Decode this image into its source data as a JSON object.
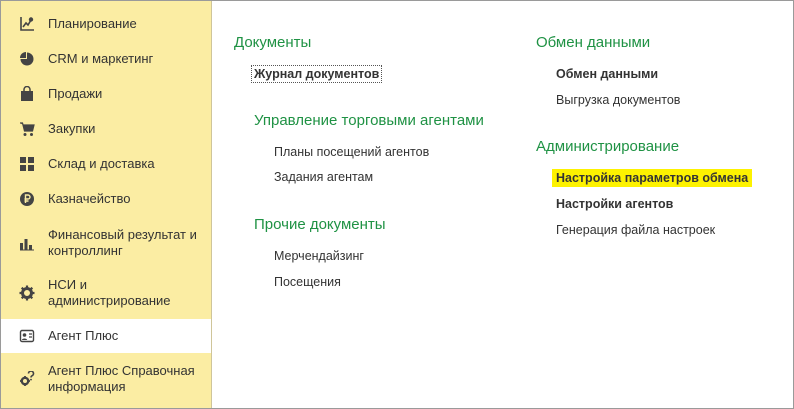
{
  "sidebar": {
    "items": [
      {
        "label": "Планирование",
        "icon": "chart-growth-icon"
      },
      {
        "label": "CRM и маркетинг",
        "icon": "pie-chart-icon"
      },
      {
        "label": "Продажи",
        "icon": "shopping-bag-icon"
      },
      {
        "label": "Закупки",
        "icon": "shopping-cart-icon"
      },
      {
        "label": "Склад и доставка",
        "icon": "grid-icon"
      },
      {
        "label": "Казначейство",
        "icon": "ruble-coin-icon"
      },
      {
        "label": "Финансовый результат и контроллинг",
        "icon": "bar-chart-icon"
      },
      {
        "label": "НСИ и администрирование",
        "icon": "gear-icon"
      },
      {
        "label": "Агент Плюс",
        "icon": "agent-plus-icon",
        "active": true
      },
      {
        "label": "Агент Плюс Справочная информация",
        "icon": "help-gear-icon"
      }
    ]
  },
  "main": {
    "documents": {
      "title": "Документы",
      "links": [
        {
          "label": "Журнал документов"
        }
      ]
    },
    "agents_management": {
      "title": "Управление торговыми агентами",
      "links": [
        {
          "label": "Планы посещений агентов"
        },
        {
          "label": "Задания агентам"
        }
      ]
    },
    "other_documents": {
      "title": "Прочие документы",
      "links": [
        {
          "label": "Мерчендайзинг"
        },
        {
          "label": "Посещения"
        }
      ]
    },
    "data_exchange": {
      "title": "Обмен данными",
      "links": [
        {
          "label": "Обмен данными"
        },
        {
          "label": "Выгрузка документов"
        }
      ]
    },
    "administration": {
      "title": "Администрирование",
      "links": [
        {
          "label": "Настройка параметров обмена"
        },
        {
          "label": "Настройки агентов"
        },
        {
          "label": "Генерация файла настроек"
        }
      ]
    }
  },
  "colors": {
    "sidebar_bg": "#fbeda3",
    "section_title": "#1f9244",
    "highlight": "#fdf200"
  }
}
